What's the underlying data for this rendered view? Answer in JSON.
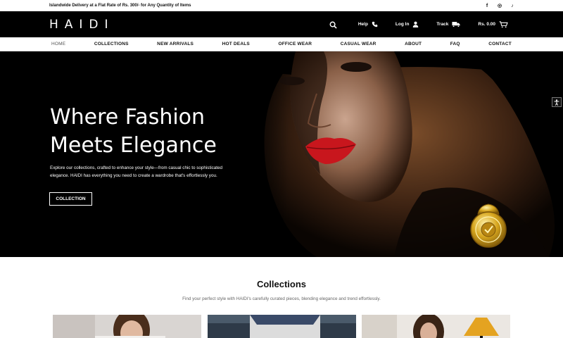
{
  "topbar": {
    "message": "Islandwide Delivery at a Flat Rate of Rs. 300/- for Any Quantity of Items",
    "socials": [
      {
        "icon": "facebook-icon",
        "glyph": "f"
      },
      {
        "icon": "instagram-icon",
        "glyph": "◎"
      },
      {
        "icon": "tiktok-icon",
        "glyph": "♪"
      }
    ]
  },
  "header": {
    "logo": "HAIDI",
    "help_label": "Help",
    "login_label": "Log In",
    "track_label": "Track",
    "cart_total": "Rs. 0.00"
  },
  "nav": {
    "items": [
      "HOME",
      "COLLECTIONS",
      "NEW ARRIVALS",
      "HOT DEALS",
      "OFFICE WEAR",
      "CASUAL WEAR",
      "ABOUT",
      "FAQ",
      "CONTACT"
    ]
  },
  "hero": {
    "title_line1": "Where Fashion",
    "title_line2": "Meets Elegance",
    "description": "Explore our collections, crafted to enhance your style—from casual chic to sophisticated elegance. HAIDI has everything you need to create a wardrobe that's effortlessly you.",
    "button_label": "COLLECTION"
  },
  "collections": {
    "title": "Collections",
    "subtitle": "Find your perfect style with HAIDI's carefully curated pieces, blending elegance and trend effortlessly."
  },
  "colors": {
    "black": "#000000",
    "white": "#ffffff",
    "lip_red": "#c8161d",
    "badge_gold": "#d4a017"
  }
}
